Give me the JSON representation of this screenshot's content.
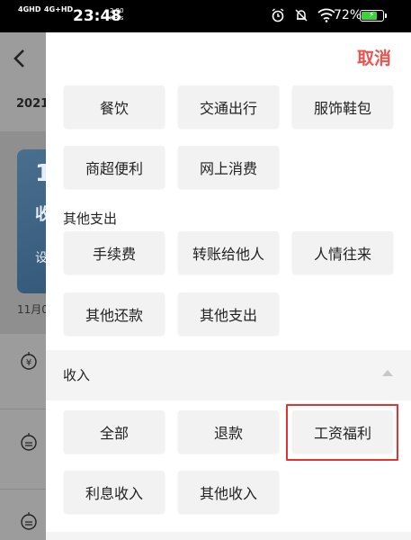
{
  "status_bar": {
    "network_1": "4GHD",
    "network_2": "4G+HD",
    "time": "23:48",
    "speed_value": "2.90",
    "speed_unit": "KB/s",
    "battery_percent": "72%",
    "icons": [
      "alarm-icon",
      "mute-icon",
      "wifi-icon",
      "battery-icon"
    ],
    "battery_color": "#3ed13e"
  },
  "background_page": {
    "date_fragment": "2021.",
    "card_big": "1",
    "card_label": "收",
    "card_sub": "设",
    "month_fragment": "11月0",
    "row_icons": [
      "yen-coin-icon",
      "coin-icon",
      "coin-icon"
    ]
  },
  "panel": {
    "cancel_label": "取消",
    "accent": "#f0504b",
    "expense_rows": [
      [
        "餐饮",
        "交通出行",
        "服饰鞋包"
      ],
      [
        "商超便利",
        "网上消费"
      ]
    ],
    "other_expense": {
      "title": "其他支出",
      "rows": [
        [
          "手续费",
          "转账给他人",
          "人情往来"
        ],
        [
          "其他还款",
          "其他支出"
        ]
      ]
    },
    "income": {
      "title": "收入",
      "rows": [
        [
          "全部",
          "退款",
          "工资福利"
        ],
        [
          "利息收入",
          "其他收入"
        ]
      ],
      "highlighted": "工资福利",
      "highlight_color": "#e23232"
    }
  }
}
